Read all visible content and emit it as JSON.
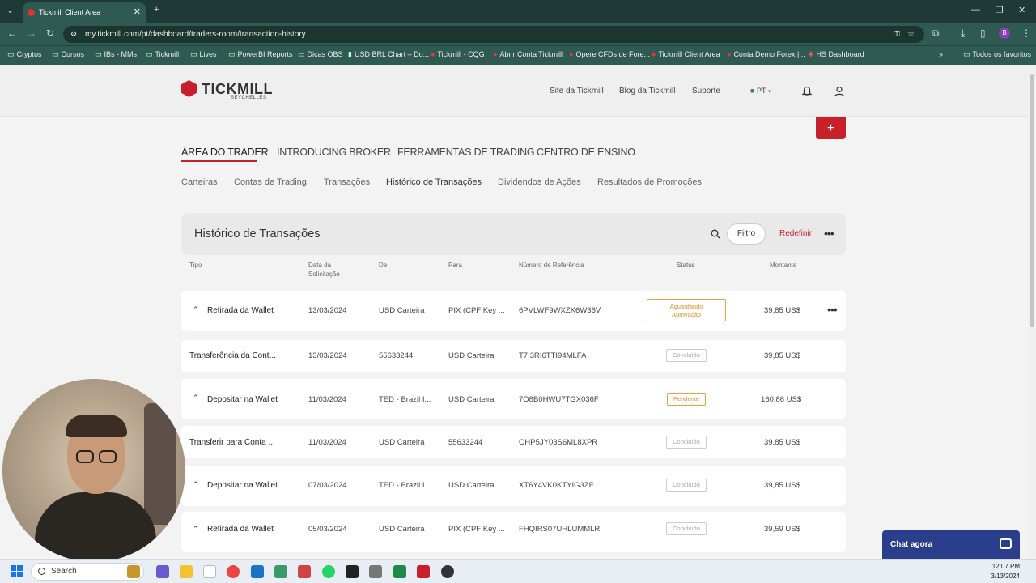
{
  "browser": {
    "tab_title": "Tickmill Client Area",
    "url": "my.tickmill.com/pt/dashboard/traders-room/transaction-history",
    "bookmarks": [
      "Cryptos",
      "Cursos",
      "IBs - MMs",
      "Tickmill",
      "Lives",
      "PowerBI Reports",
      "Dicas OBS",
      "USD BRL Chart – Do...",
      "Tickmill - CQG",
      "Abrir Conta Tickmill",
      "Opere CFDs de Fore...",
      "Tickmill Client Area",
      "Conta Demo Forex |...",
      "HS Dashboard"
    ],
    "all_bookmarks": "Todos os favoritos",
    "profile_initial": "B"
  },
  "header": {
    "logo": "TICKMILL",
    "logo_sub": "SEYCHELLES",
    "links": [
      "Site da Tickmill",
      "Blog da Tickmill",
      "Suporte"
    ],
    "language": "PT",
    "plus": "+"
  },
  "nav": {
    "main_tabs": [
      "ÁREA DO TRADER",
      "INTRODUCING BROKER",
      "FERRAMENTAS DE TRADING",
      "CENTRO DE ENSINO"
    ],
    "sub_tabs": [
      "Carteiras",
      "Contas de Trading",
      "Transações",
      "Histórico de Transações",
      "Dividendos de Ações",
      "Resultados de Promoções"
    ]
  },
  "panel": {
    "title": "Histórico de Transações",
    "filter_label": "Filtro",
    "reset_label": "Redefinir",
    "more": "•••"
  },
  "table": {
    "columns": {
      "tipo": "Tipo",
      "data_l1": "Data da",
      "data_l2": "Solicitação",
      "de": "De",
      "para": "Para",
      "ref": "Número de Referência",
      "status": "Status",
      "montante": "Montante"
    },
    "rows": [
      {
        "tipo": "Retirada da Wallet",
        "data": "13/03/2024",
        "de": "USD Carteira",
        "para": "PIX (CPF Key ...",
        "ref": "6PVLWF9WXZK6W36V",
        "status_l1": "Aguardando",
        "status_l2": "Aprovação",
        "montante": "39,85 US$",
        "more": "•••"
      },
      {
        "tipo": "Transferência da Cont...",
        "data": "13/03/2024",
        "de": "55633244",
        "para": "USD Carteira",
        "ref": "T7I3RI6TTI94MLFA",
        "status": "Concluído",
        "montante": "39,85 US$"
      },
      {
        "tipo": "Depositar na Wallet",
        "data": "11/03/2024",
        "de": "TED - Brazil I...",
        "para": "USD Carteira",
        "ref": "7O8B0HWU7TGX036F",
        "status": "Pendente",
        "montante": "160,86 US$"
      },
      {
        "tipo": "Transferir para Conta ...",
        "data": "11/03/2024",
        "de": "USD Carteira",
        "para": "55633244",
        "ref": "OHP5JY03S6ML8XPR",
        "status": "Concluído",
        "montante": "39,85 US$"
      },
      {
        "tipo": "Depositar na Wallet",
        "data": "07/03/2024",
        "de": "TED - Brazil I...",
        "para": "USD Carteira",
        "ref": "XT6Y4VK0KTYIG3ZE",
        "status": "Concluído",
        "montante": "39,85 US$"
      },
      {
        "tipo": "Retirada da Wallet",
        "data": "05/03/2024",
        "de": "USD Carteira",
        "para": "PIX (CPF Key ...",
        "ref": "FHQIRS07UHLUMMLR",
        "status": "Concluído",
        "montante": "39,59 US$"
      }
    ]
  },
  "chat": {
    "label": "Chat agora"
  },
  "taskbar": {
    "search": "Search",
    "time": "12:07 PM",
    "date": "3/13/2024"
  },
  "colors": {
    "brand_red": "#c8202a",
    "chat_blue": "#2b3e8c",
    "pending_orange": "#e0902a",
    "browser_green": "#2e5a52"
  }
}
